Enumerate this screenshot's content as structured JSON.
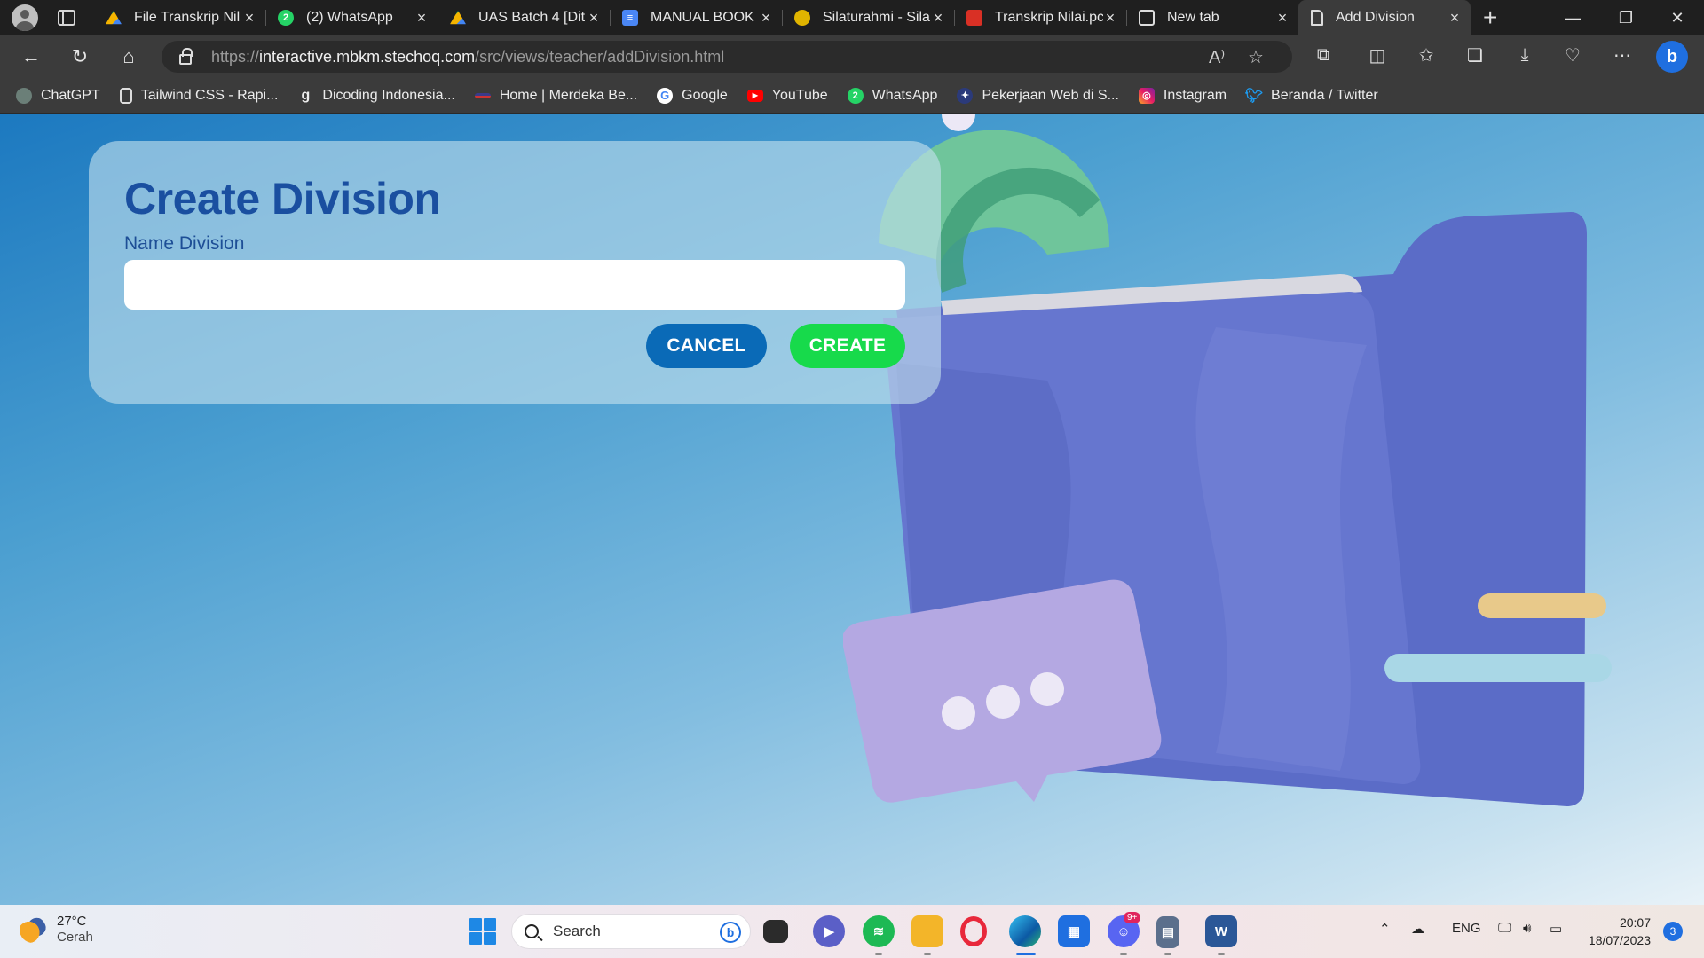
{
  "browser": {
    "tabs": [
      {
        "title": "File Transkrip Nil",
        "icon": "google-drive-icon"
      },
      {
        "title": "(2) WhatsApp",
        "icon": "whatsapp-icon"
      },
      {
        "title": "UAS Batch 4 [Dit",
        "icon": "google-drive-icon"
      },
      {
        "title": "MANUAL BOOK I",
        "icon": "google-docs-icon"
      },
      {
        "title": "Silaturahmi - Sila",
        "icon": "university-seal-icon"
      },
      {
        "title": "Transkrip Nilai.pc",
        "icon": "pdf-icon"
      },
      {
        "title": "New tab",
        "icon": "new-tab-icon"
      },
      {
        "title": "Add Division",
        "icon": "page-icon"
      }
    ],
    "active_tab": "Add Division",
    "url_scheme": "https://",
    "url_host": "interactive.mbkm.stechoq.com",
    "url_path": "/src/views/teacher/addDivision.html",
    "bookmarks": [
      {
        "label": "ChatGPT",
        "icon": "chatgpt-icon"
      },
      {
        "label": "Tailwind CSS - Rapi...",
        "icon": "page-icon"
      },
      {
        "label": "Dicoding Indonesia...",
        "icon": "dicoding-icon"
      },
      {
        "label": "Home | Merdeka Be...",
        "icon": "merdeka-icon"
      },
      {
        "label": "Google",
        "icon": "google-icon"
      },
      {
        "label": "YouTube",
        "icon": "youtube-icon"
      },
      {
        "label": "WhatsApp",
        "icon": "whatsapp-icon"
      },
      {
        "label": "Pekerjaan Web di S...",
        "icon": "jobs-icon"
      },
      {
        "label": "Instagram",
        "icon": "instagram-icon"
      },
      {
        "label": "Beranda / Twitter",
        "icon": "twitter-icon"
      }
    ]
  },
  "form": {
    "title": "Create Division",
    "name_label": "Name Division",
    "name_value": "",
    "cancel_label": "CANCEL",
    "create_label": "CREATE"
  },
  "colors": {
    "title": "#1a4fa0",
    "cancel_button": "#0a6ab7",
    "create_button": "#17da4b"
  },
  "taskbar": {
    "weather_temp": "27°C",
    "weather_desc": "Cerah",
    "search_placeholder": "Search",
    "search_notif": "9+",
    "lang": "ENG",
    "time": "20:07",
    "date": "18/07/2023",
    "notifications": "3"
  }
}
